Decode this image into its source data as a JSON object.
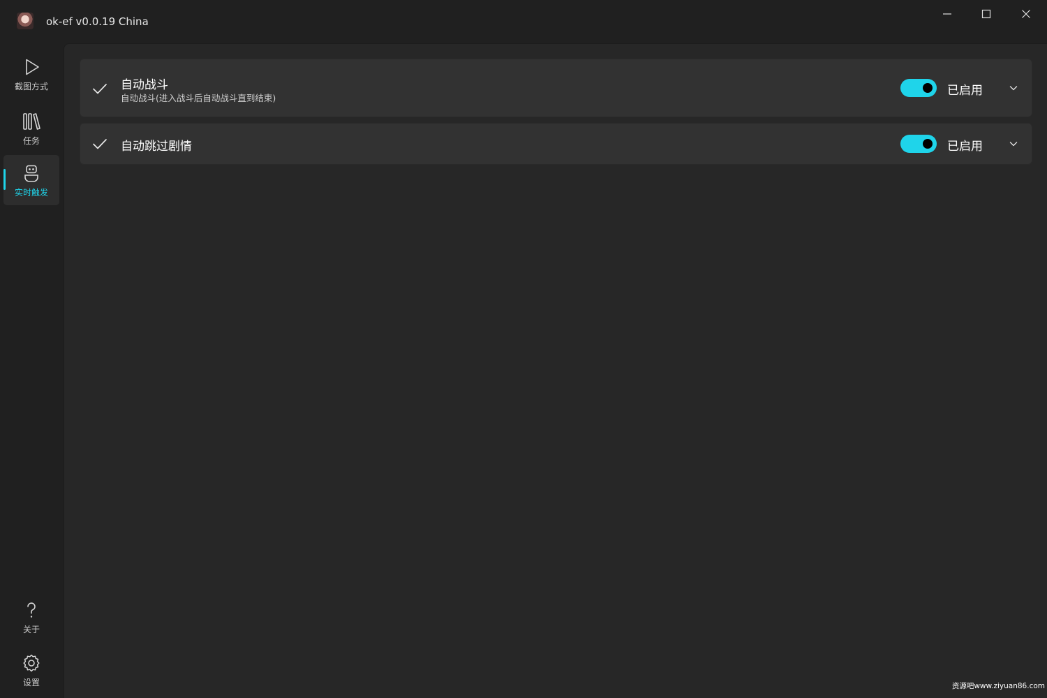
{
  "window": {
    "title": "ok-ef v0.0.19 China",
    "controls": [
      "minimize-icon",
      "maximize-icon",
      "close-icon"
    ]
  },
  "sidebar": {
    "items": [
      {
        "label": "截图方式",
        "icon": "play-icon",
        "active": false
      },
      {
        "label": "任务",
        "icon": "library-icon",
        "active": false
      },
      {
        "label": "实时触发",
        "icon": "robot-icon",
        "active": true
      }
    ],
    "bottom_items": [
      {
        "label": "关于",
        "icon": "question-icon"
      },
      {
        "label": "设置",
        "icon": "gear-icon"
      }
    ]
  },
  "tasks": [
    {
      "title": "自动战斗",
      "description": "自动战斗(进入战斗后自动战斗直到结束)",
      "enabled": true,
      "status_label": "已启用"
    },
    {
      "title": "自动跳过剧情",
      "description": "",
      "enabled": true,
      "status_label": "已启用"
    }
  ],
  "watermark": "资源吧www.ziyuan86.com",
  "colors": {
    "accent": "#1fd4ea",
    "background": "#202020",
    "content_background": "#272727",
    "card_background": "#323232"
  }
}
